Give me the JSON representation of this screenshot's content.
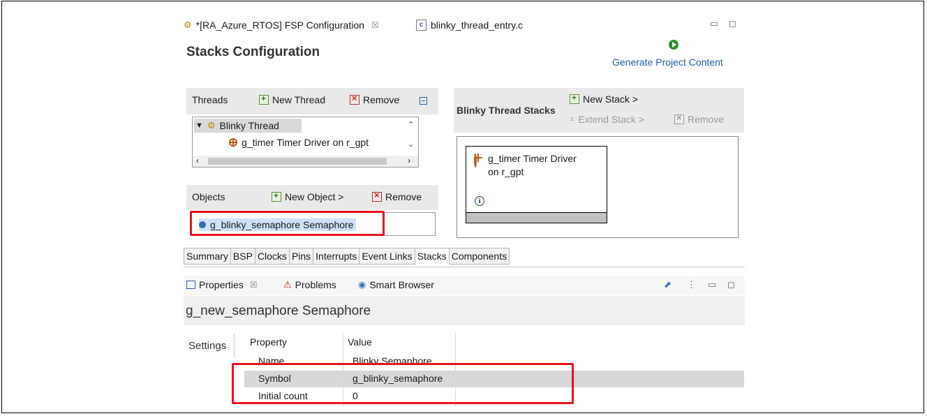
{
  "editor_tabs": [
    {
      "label": "*[RA_Azure_RTOS] FSP Configuration",
      "icon": "gear-icon",
      "close": "☒"
    },
    {
      "label": "blinky_thread_entry.c",
      "icon": "c-file-icon"
    }
  ],
  "stacks_config": {
    "title": "Stacks Configuration",
    "generate_label": "Generate Project Content"
  },
  "threads": {
    "label": "Threads",
    "new_thread": "New Thread",
    "remove": "Remove",
    "tree": [
      {
        "label": "Blinky Thread",
        "icon": "gear-icon",
        "expanded": true
      },
      {
        "label": "g_timer Timer Driver on r_gpt",
        "icon": "module-icon"
      }
    ]
  },
  "objects": {
    "label": "Objects",
    "new_object": "New Object >",
    "remove": "Remove",
    "items": [
      "g_blinky_semaphore Semaphore"
    ]
  },
  "thread_stacks": {
    "label": "Blinky Thread Stacks",
    "new_stack": "New Stack >",
    "extend_stack": "Extend Stack >",
    "remove": "Remove",
    "card_line1": "g_timer Timer Driver",
    "card_line2": "on r_gpt"
  },
  "config_tabs": [
    "Summary",
    "BSP",
    "Clocks",
    "Pins",
    "Interrupts",
    "Event Links",
    "Stacks",
    "Components"
  ],
  "active_config_tab": "Stacks",
  "view_tabs": {
    "properties": "Properties",
    "close": "☒",
    "problems": "Problems",
    "smart_browser": "Smart Browser"
  },
  "properties": {
    "title": "g_new_semaphore Semaphore",
    "side_tab": "Settings",
    "col_property": "Property",
    "col_value": "Value",
    "rows": [
      {
        "property": "Name",
        "value": "Blinky Semaphore"
      },
      {
        "property": "Symbol",
        "value": "g_blinky_semaphore"
      },
      {
        "property": "Initial count",
        "value": "0"
      }
    ]
  },
  "colors": {
    "highlight_box": "#e8121d",
    "link": "#1f5aa6"
  }
}
